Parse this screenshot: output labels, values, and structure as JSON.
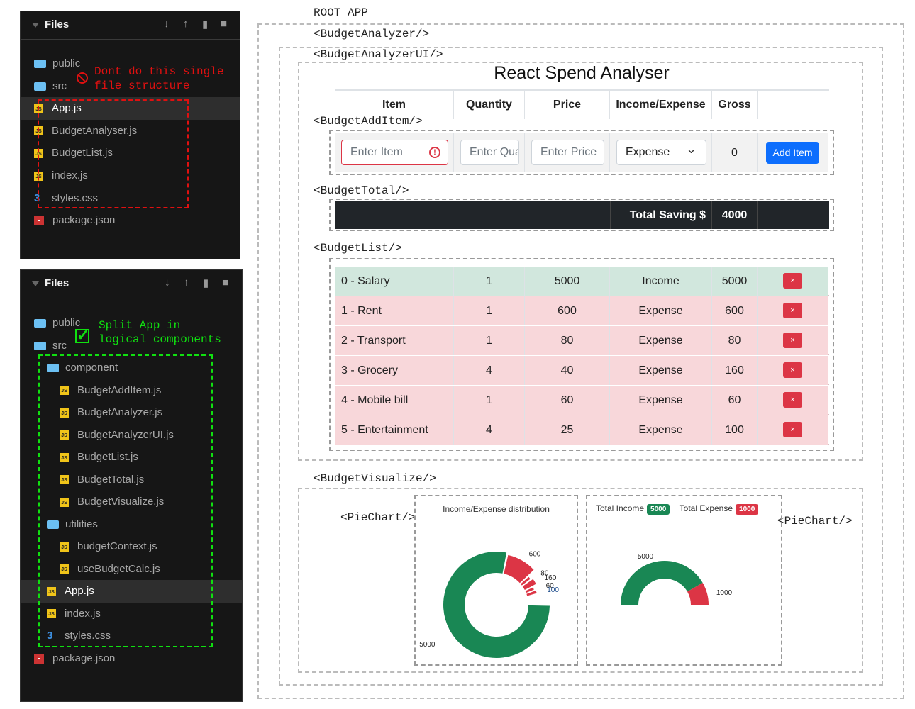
{
  "sidebar_bad": {
    "title": "Files",
    "note": [
      "Dont do this single",
      "file structure"
    ],
    "items": [
      {
        "label": "public",
        "type": "folder"
      },
      {
        "label": "src",
        "type": "folder-open"
      },
      {
        "label": "App.js",
        "type": "js",
        "active": true
      },
      {
        "label": "BudgetAnalyser.js",
        "type": "js"
      },
      {
        "label": "BudgetList.js",
        "type": "js"
      },
      {
        "label": "index.js",
        "type": "js"
      },
      {
        "label": "styles.css",
        "type": "css"
      },
      {
        "label": "package.json",
        "type": "pkg"
      }
    ]
  },
  "sidebar_good": {
    "title": "Files",
    "note": [
      "Split App in",
      "logical components"
    ],
    "items": [
      {
        "label": "public",
        "type": "folder"
      },
      {
        "label": "src",
        "type": "folder-open"
      },
      {
        "label": "component",
        "type": "folder-open",
        "indent": 1
      },
      {
        "label": "BudgetAddItem.js",
        "type": "js",
        "indent": 2
      },
      {
        "label": "BudgetAnalyzer.js",
        "type": "js",
        "indent": 2
      },
      {
        "label": "BudgetAnalyzerUI.js",
        "type": "js",
        "indent": 2
      },
      {
        "label": "BudgetList.js",
        "type": "js",
        "indent": 2
      },
      {
        "label": "BudgetTotal.js",
        "type": "js",
        "indent": 2
      },
      {
        "label": "BudgetVisualize.js",
        "type": "js",
        "indent": 2
      },
      {
        "label": "utilities",
        "type": "folder-open",
        "indent": 1
      },
      {
        "label": "budgetContext.js",
        "type": "js",
        "indent": 2
      },
      {
        "label": "useBudgetCalc.js",
        "type": "js",
        "indent": 2
      },
      {
        "label": "App.js",
        "type": "js",
        "indent": 1,
        "active": true
      },
      {
        "label": "index.js",
        "type": "js",
        "indent": 1
      },
      {
        "label": "styles.css",
        "type": "css",
        "indent": 1
      },
      {
        "label": "package.json",
        "type": "pkg"
      }
    ]
  },
  "labels": {
    "root": "ROOT APP",
    "analyzer": "<BudgetAnalyzer/>",
    "analyzer_ui": "<BudgetAnalyzerUI/>",
    "add_item": "<BudgetAddItem/>",
    "total": "<BudgetTotal/>",
    "list": "<BudgetList/>",
    "visualize": "<BudgetVisualize/>",
    "pie1": "<PieChart/>",
    "pie2": "<PieChart/>"
  },
  "app": {
    "title": "React Spend Analyser",
    "headers": [
      "Item",
      "Quantity",
      "Price",
      "Income/Expense",
      "Gross"
    ],
    "form": {
      "item_placeholder": "Enter Item",
      "qty_placeholder": "Enter Quantity",
      "price_placeholder": "Enter Price",
      "type_value": "Expense",
      "gross": "0",
      "add_label": "Add Item"
    },
    "total": {
      "label": "Total Saving $",
      "value": "4000"
    },
    "rows": [
      [
        "0 - Salary",
        "1",
        "5000",
        "Income",
        "5000"
      ],
      [
        "1 - Rent",
        "1",
        "600",
        "Expense",
        "600"
      ],
      [
        "2 - Transport",
        "1",
        "80",
        "Expense",
        "80"
      ],
      [
        "3 - Grocery",
        "4",
        "40",
        "Expense",
        "160"
      ],
      [
        "4 - Mobile bill",
        "1",
        "60",
        "Expense",
        "60"
      ],
      [
        "5 - Entertainment",
        "4",
        "25",
        "Expense",
        "100"
      ]
    ],
    "delete_label": "×",
    "colors": {
      "income_row": "#d1e7dd",
      "expense_row": "#f8d7da",
      "primary": "#0d6efd",
      "danger": "#dc3545",
      "success": "#198754",
      "dark": "#212529"
    }
  },
  "chart_data": [
    {
      "type": "pie",
      "title": "Income/Expense distribution",
      "values": [
        5000,
        600,
        80,
        160,
        60,
        100
      ],
      "labels": [
        "5000",
        "600",
        "80",
        "160",
        "60",
        "100"
      ],
      "colors": [
        "#198754",
        "#dc3545",
        "#dc3545",
        "#dc3545",
        "#dc3545",
        "#dc3545"
      ]
    },
    {
      "type": "pie",
      "variant": "half-donut",
      "legend": [
        {
          "label": "Total Income",
          "value": "5000",
          "color": "#198754"
        },
        {
          "label": "Total Expense",
          "value": "1000",
          "color": "#dc3545"
        }
      ],
      "values": [
        5000,
        1000
      ],
      "labels": [
        "5000",
        "1000"
      ]
    }
  ]
}
